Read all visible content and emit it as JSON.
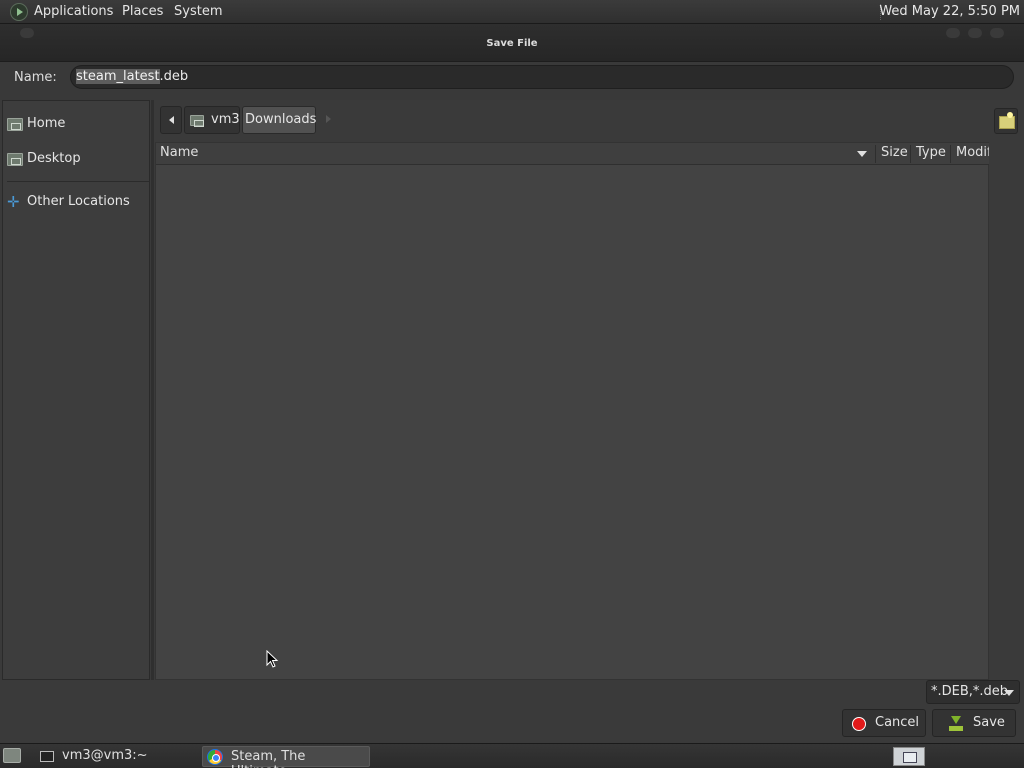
{
  "top_panel": {
    "menus": [
      "Applications",
      "Places",
      "System"
    ],
    "clock": "Wed May 22,  5:50 PM"
  },
  "dialog": {
    "title": "Save File",
    "name_label": "Name:",
    "filename_selected": "steam_latest",
    "filename_rest": ".deb",
    "sidebar": {
      "items": [
        {
          "label": "Home",
          "icon": "folder-home-icon"
        },
        {
          "label": "Desktop",
          "icon": "folder-icon"
        },
        {
          "label": "Other Locations",
          "icon": "plus-icon"
        }
      ]
    },
    "pathbar": {
      "segments": [
        "vm3",
        "Downloads"
      ],
      "active": "Downloads"
    },
    "columns": [
      "Name",
      "Size",
      "Type",
      "Modif"
    ],
    "filter": "*.DEB,*.deb",
    "buttons": {
      "cancel": "Cancel",
      "save": "Save"
    }
  },
  "taskbar": {
    "tasks": [
      {
        "label": "vm3@vm3:~",
        "icon": "terminal-icon"
      },
      {
        "label": "Steam, The Ultimate...",
        "icon": "chrome-icon",
        "active": true
      }
    ]
  }
}
